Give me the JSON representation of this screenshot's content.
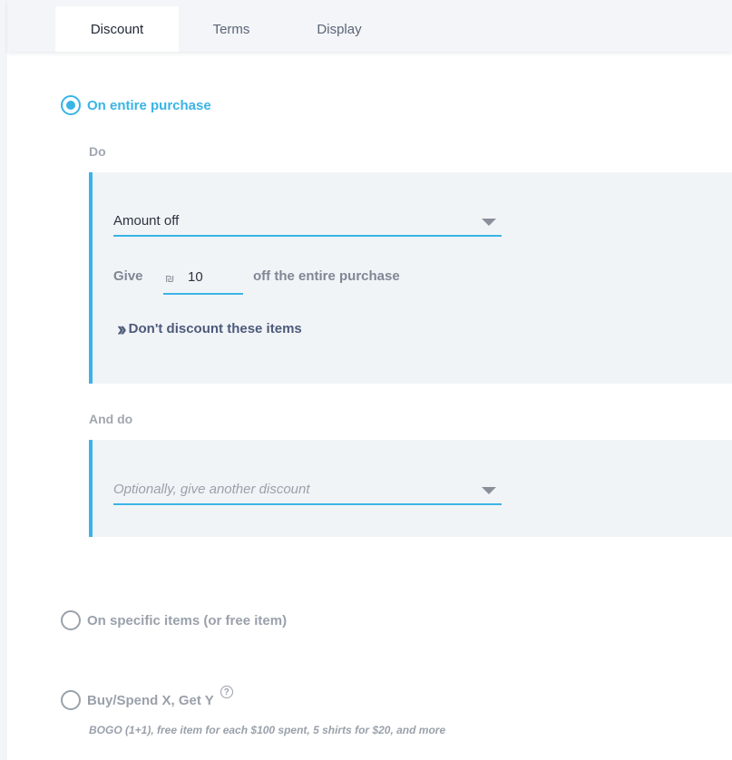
{
  "tabs": [
    {
      "label": "Discount",
      "active": true
    },
    {
      "label": "Terms",
      "active": false
    },
    {
      "label": "Display",
      "active": false
    }
  ],
  "options": {
    "entire_purchase": {
      "label": "On entire purchase",
      "selected": true
    },
    "specific_items": {
      "label": "On specific items (or free item)",
      "selected": false
    },
    "buy_spend": {
      "label": "Buy/Spend X, Get Y",
      "selected": false,
      "hint": "BOGO (1+1), free item for each $100 spent, 5 shirts for $20, and more"
    }
  },
  "do_section": {
    "label": "Do",
    "discount_type": {
      "value": "Amount off"
    },
    "give_label": "Give",
    "currency_symbol": "₪",
    "amount": "10",
    "off_text": "off the entire purchase",
    "exclude_link": "Don't discount these items"
  },
  "and_do_section": {
    "label": "And do",
    "select_placeholder": "Optionally, give another discount"
  },
  "colors": {
    "accent": "#3ab4e6",
    "panel_bg": "#f1f4f7",
    "muted_text": "#9aa1ab",
    "link": "#4d5a7a"
  },
  "icons": {
    "exclude": "double-chevron-right-icon",
    "dropdown": "caret-down-icon",
    "help": "question-circle-icon"
  }
}
